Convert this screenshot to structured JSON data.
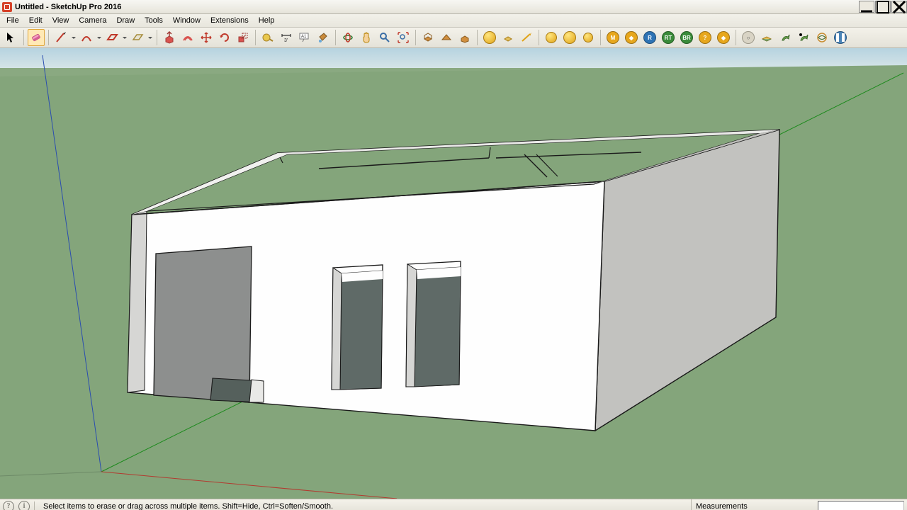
{
  "window": {
    "title": "Untitled - SketchUp Pro 2016"
  },
  "menu": [
    "File",
    "Edit",
    "View",
    "Camera",
    "Draw",
    "Tools",
    "Window",
    "Extensions",
    "Help"
  ],
  "statusbar": {
    "hint": "Select items to erase or drag across multiple items. Shift=Hide, Ctrl=Soften/Smooth.",
    "measurements_label": "Measurements"
  },
  "active_tool": "eraser",
  "toolbar_groups": [
    [
      "select",
      "eraser"
    ],
    [
      "line",
      "arc",
      "rectangle",
      "circle",
      "polygon"
    ],
    [
      "pushpull",
      "followme",
      "move",
      "rotate",
      "scale",
      "offset"
    ],
    [
      "tape",
      "protractor",
      "text",
      "dimension",
      "paint"
    ],
    [
      "orbit",
      "pan",
      "zoom",
      "zoom-extents"
    ],
    [
      "section",
      "sun",
      "shadows"
    ],
    [
      "iso",
      "top",
      "front",
      "right",
      "back",
      "left"
    ],
    [
      "m",
      "i",
      "r",
      "rt",
      "br",
      "q",
      "d",
      "x",
      "y",
      "z",
      "a",
      "b",
      "c",
      "pause"
    ]
  ]
}
